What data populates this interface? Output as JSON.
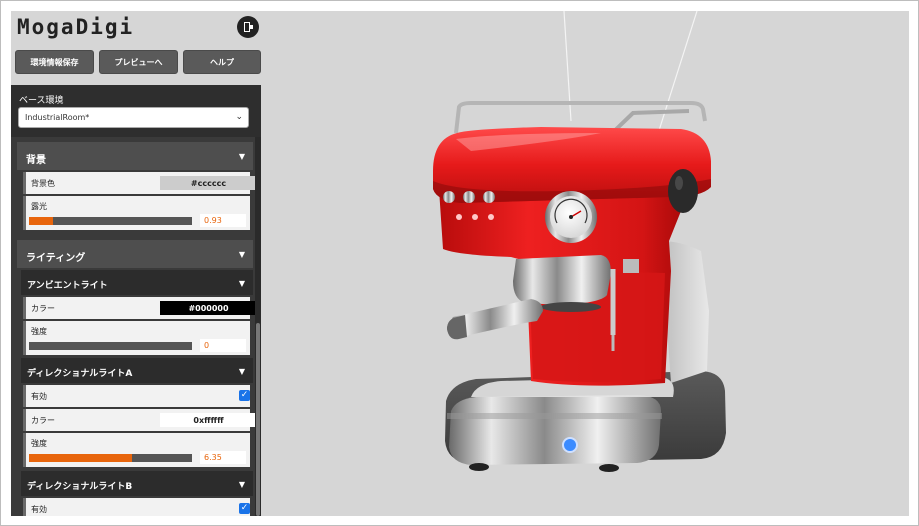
{
  "app": {
    "title": "MogaDigi"
  },
  "toolbar": {
    "save_label": "環境情報保存",
    "preview_label": "プレビューへ",
    "help_label": "ヘルプ"
  },
  "base_env": {
    "label": "ベース環境",
    "selected": "IndustrialRoom*"
  },
  "background": {
    "title": "背景",
    "color_label": "背景色",
    "color_value": "#cccccc",
    "exposure_label": "露光",
    "exposure_value": "0.93",
    "exposure_fraction": 0.15
  },
  "lighting": {
    "title": "ライティング",
    "ambient": {
      "title": "アンビエントライト",
      "color_label": "カラー",
      "color_value": "#000000",
      "intensity_label": "強度",
      "intensity_value": "0",
      "intensity_fraction": 0.0
    },
    "dir_a": {
      "title": "ディレクショナルライトA",
      "enabled_label": "有効",
      "enabled": true,
      "color_label": "カラー",
      "color_value": "0xffffff",
      "intensity_label": "強度",
      "intensity_value": "6.35",
      "intensity_fraction": 0.63
    },
    "dir_b": {
      "title": "ディレクショナルライトB",
      "enabled_label": "有効",
      "enabled": true
    }
  },
  "icons": {
    "exit": "door-exit-icon",
    "dropdown": "chevron-down-icon",
    "collapse": "triangle-down-icon",
    "checkbox": "check-icon"
  },
  "colors": {
    "accent": "#e8650c",
    "checkbox": "#1a73e8",
    "machine_red": "#e01818"
  }
}
